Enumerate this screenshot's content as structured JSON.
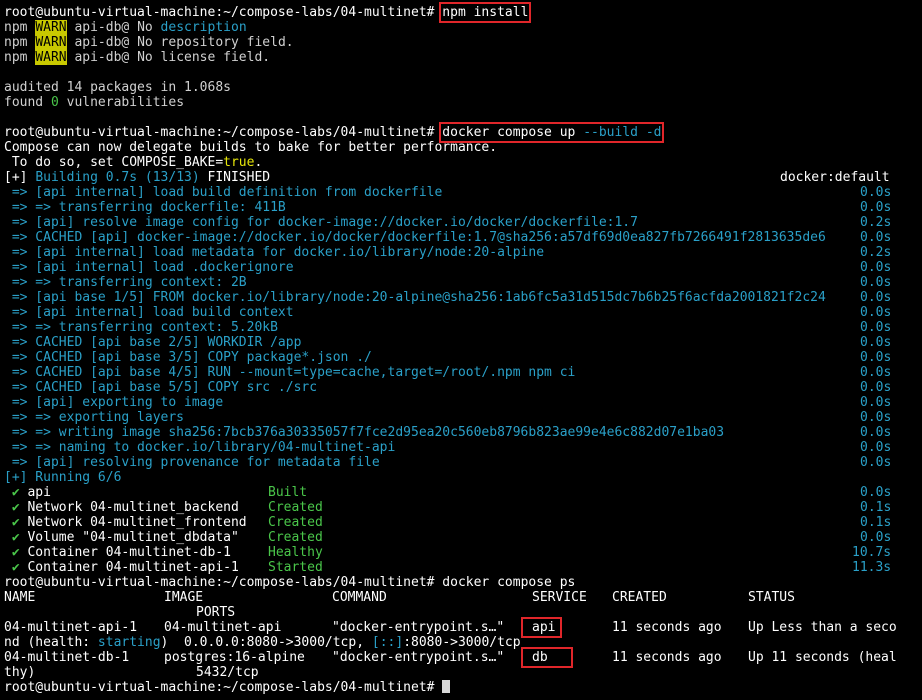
{
  "prompt": "root@ubuntu-virtual-machine:~/compose-labs/04-multinet# ",
  "npm": {
    "command": "npm install",
    "warn_prefix": "npm",
    "warn_tag": "WARN",
    "warns": [
      {
        "pkg": " api-db@ No ",
        "text": "description",
        "hl": true
      },
      {
        "pkg": " api-db@ No repository field.",
        "text": "",
        "hl": false
      },
      {
        "pkg": " api-db@ No license field.",
        "text": "",
        "hl": false
      }
    ],
    "audited": "audited 14 packages in 1.068s",
    "found_prefix": "found ",
    "found_count": "0",
    "found_suffix": " vulnerabilities"
  },
  "compose": {
    "command": "docker compose up --build -d",
    "bake1": "Compose can now delegate builds to bake for better performance.",
    "bake2_prefix": " To do so, set COMPOSE_BAKE=",
    "bake2_value": "true",
    "bake2_suffix": ".",
    "build_header": {
      "prefix": "[+] ",
      "text": "Building 0.7s (13/13) ",
      "state": "FINISHED",
      "driver": "docker:default"
    },
    "steps": [
      {
        "text": " => [api internal] load build definition from dockerfile",
        "time": "0.0s"
      },
      {
        "text": " => => transferring dockerfile: 411B",
        "time": "0.0s"
      },
      {
        "text": " => [api] resolve image config for docker-image://docker.io/docker/dockerfile:1.7",
        "time": "0.2s"
      },
      {
        "text": " => CACHED [api] docker-image://docker.io/docker/dockerfile:1.7@sha256:a57df69d0ea827fb7266491f2813635de6",
        "time": "0.0s"
      },
      {
        "text": " => [api internal] load metadata for docker.io/library/node:20-alpine",
        "time": "0.2s"
      },
      {
        "text": " => [api internal] load .dockerignore",
        "time": "0.0s"
      },
      {
        "text": " => => transferring context: 2B",
        "time": "0.0s"
      },
      {
        "text": " => [api base 1/5] FROM docker.io/library/node:20-alpine@sha256:1ab6fc5a31d515dc7b6b25f6acfda2001821f2c24",
        "time": "0.0s"
      },
      {
        "text": " => [api internal] load build context",
        "time": "0.0s"
      },
      {
        "text": " => => transferring context: 5.20kB",
        "time": "0.0s"
      },
      {
        "text": " => CACHED [api base 2/5] WORKDIR /app",
        "time": "0.0s"
      },
      {
        "text": " => CACHED [api base 3/5] COPY package*.json ./",
        "time": "0.0s"
      },
      {
        "text": " => CACHED [api base 4/5] RUN --mount=type=cache,target=/root/.npm npm ci",
        "time": "0.0s"
      },
      {
        "text": " => CACHED [api base 5/5] COPY src ./src",
        "time": "0.0s"
      },
      {
        "text": " => [api] exporting to image",
        "time": "0.0s"
      },
      {
        "text": " => => exporting layers",
        "time": "0.0s"
      },
      {
        "text": " => => writing image sha256:7bcb376a30335057f7fce2d95ea20c560eb8796b823ae99e4e6c882d07e1ba03",
        "time": "0.0s"
      },
      {
        "text": " => => naming to docker.io/library/04-multinet-api",
        "time": "0.0s"
      },
      {
        "text": " => [api] resolving provenance for metadata file",
        "time": "0.0s"
      }
    ],
    "running_header": "[+] Running 6/6",
    "results": [
      {
        "check": "✔",
        "name": "api",
        "status": "Built",
        "time": "0.0s"
      },
      {
        "check": "✔",
        "name": "Network 04-multinet_backend",
        "status": "Created",
        "time": "0.1s"
      },
      {
        "check": "✔",
        "name": "Network 04-multinet_frontend",
        "status": "Created",
        "time": "0.1s"
      },
      {
        "check": "✔",
        "name": "Volume \"04-multinet_dbdata\"",
        "status": "Created",
        "time": "0.0s"
      },
      {
        "check": "✔",
        "name": "Container 04-multinet-db-1",
        "status": "Healthy",
        "time": "10.7s"
      },
      {
        "check": "✔",
        "name": "Container 04-multinet-api-1",
        "status": "Started",
        "time": "11.3s"
      }
    ]
  },
  "ps": {
    "command": "docker compose ps",
    "headers": {
      "name": "NAME",
      "image": "IMAGE",
      "command": "COMMAND",
      "service": "SERVICE",
      "created": "CREATED",
      "status": "STATUS",
      "ports": "PORTS"
    },
    "rows": [
      {
        "name": "04-multinet-api-1",
        "image": "04-multinet-api",
        "command": "\"docker-entrypoint.s…\"",
        "service": "api",
        "created": "11 seconds ago",
        "status": "Up Less than a seco",
        "wrap_prefix": "nd (health: ",
        "wrap_health": "starting",
        "wrap_mid": ")  0.0.0.0:8080->3000/tcp, ",
        "wrap_v6": "[::]",
        "wrap_tail": ":8080->3000/tcp"
      },
      {
        "name": "04-multinet-db-1",
        "image": "postgres:16-alpine",
        "command": "\"docker-entrypoint.s…\"",
        "service": "db",
        "created": "11 seconds ago",
        "status": "Up 11 seconds (heal",
        "wrap_prefix": "thy)",
        "wrap_ports": "5432/tcp"
      }
    ]
  },
  "colors": {
    "background": "#000000",
    "text": "#d0d0d0",
    "build_step": "#2aa0c8",
    "success": "#4ac64a",
    "warn_bg": "#c9c900",
    "highlight_box": "#e0262a"
  }
}
